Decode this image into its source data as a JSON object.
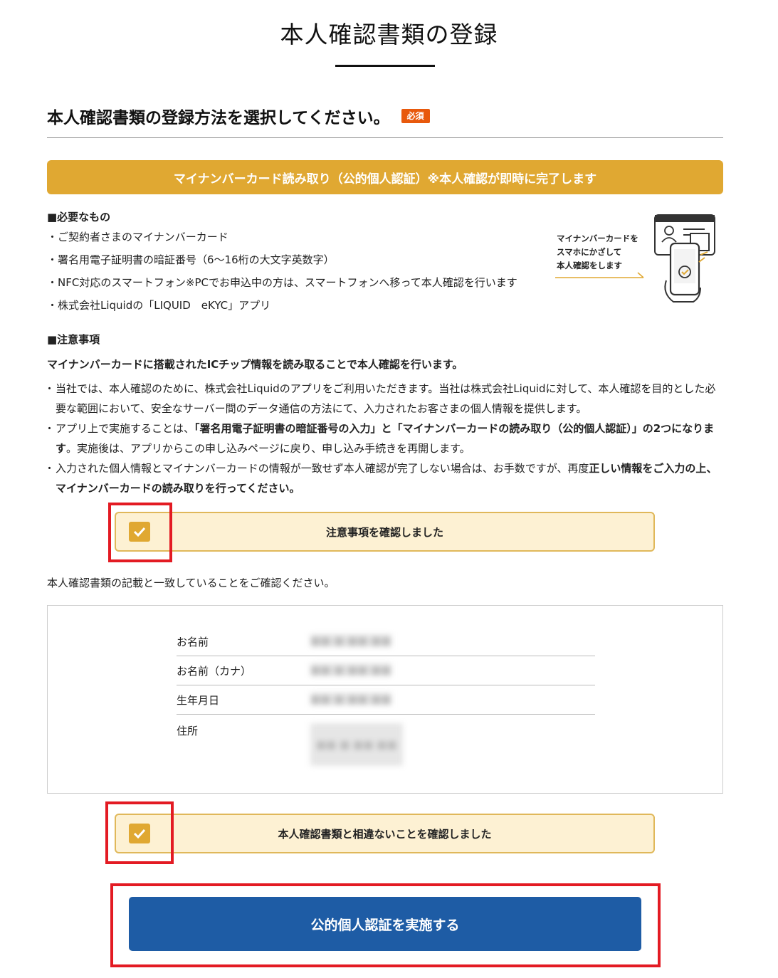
{
  "header": {
    "title": "本人確認書類の登録"
  },
  "section": {
    "heading": "本人確認書類の登録方法を選択してください。",
    "required_badge": "必須",
    "method_banner": "マイナンバーカード読み取り（公的個人認証）※本人確認が即時に完了します"
  },
  "requirements": {
    "heading": "■必要なもの",
    "items": [
      "・ご契約者さまのマイナンバーカード",
      "・署名用電子証明書の暗証番号（6〜16桁の大文字英数字）",
      "・NFC対応のスマートフォン※PCでお申込中の方は、スマートフォンへ移って本人確認を行います",
      "・株式会社Liquidの「LIQUID　eKYC」アプリ"
    ]
  },
  "illustration": {
    "line1": "マイナンバーカードを",
    "line2": "スマホにかざして",
    "line3": "本人確認をします"
  },
  "notes": {
    "heading": "■注意事項",
    "lead": "マイナンバーカードに搭載されたICチップ情報を読み取ることで本人確認を行います。",
    "item1": "当社では、本人確認のために、株式会社Liquidのアプリをご利用いただきます。当社は株式会社Liquidに対して、本人確認を目的とした必要な範囲において、安全なサーバー間のデータ通信の方法にて、入力されたお客さまの個人情報を提供します。",
    "item2_pre": "アプリ上で実施することは、",
    "item2_bold": "「署名用電子証明書の暗証番号の入力」と「マイナンバーカードの読み取り（公的個人認証）」の2つになります",
    "item2_post": "。実施後は、アプリからこの申し込みページに戻り、申し込み手続きを再開します。",
    "item3_pre": "入力された個人情報とマイナンバーカードの情報が一致せず本人確認が完了しない場合は、お手数ですが、再度",
    "item3_bold": "正しい情報をご入力の上、マイナンバーカードの読み取りを行ってください。"
  },
  "confirm_notes": {
    "label": "注意事項を確認しました",
    "checked": true
  },
  "verify": {
    "prompt": "本人確認書類の記載と一致していることをご確認ください。",
    "rows": [
      {
        "label": "お名前",
        "value": "■■ ■ ■■ ■■"
      },
      {
        "label": "お名前（カナ）",
        "value": "■■ ■ ■■ ■■"
      },
      {
        "label": "生年月日",
        "value": "■■ ■ ■■ ■■"
      },
      {
        "label": "住所",
        "value": "■■ ■ ■■ ■■"
      }
    ]
  },
  "confirm_match": {
    "label": "本人確認書類と相違ないことを確認しました",
    "checked": true
  },
  "submit": {
    "label": "公的個人認証を実施する"
  },
  "colors": {
    "accent_gold": "#e0a832",
    "badge_orange": "#e8590c",
    "button_blue": "#1e5ca5",
    "highlight_red": "#e31b23"
  }
}
